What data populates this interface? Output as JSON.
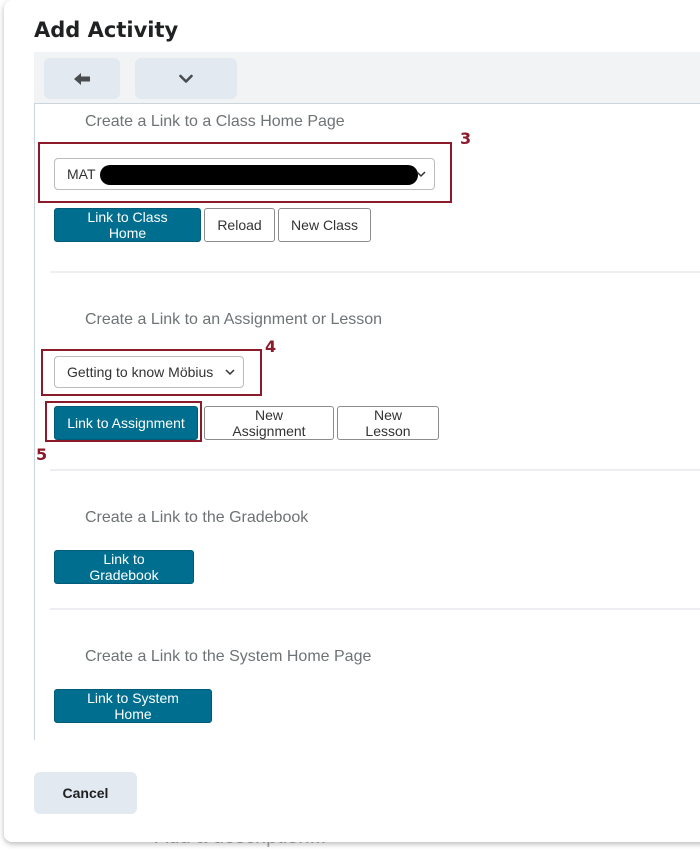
{
  "background": {
    "description_placeholder": "Add a description..."
  },
  "dialog": {
    "title": "Add Activity",
    "toolbar": {
      "back_icon": "arrow-left-icon",
      "menu_icon": "chevron-down-icon"
    },
    "cancel_label": "Cancel"
  },
  "sections": {
    "class_home": {
      "title": "Create a Link to a Class Home Page",
      "select_value": "MAT",
      "buttons": {
        "link": "Link to Class Home",
        "reload": "Reload",
        "new_class": "New Class"
      }
    },
    "assignment": {
      "title": "Create a Link to an Assignment or Lesson",
      "select_value": "Getting to know Möbius",
      "buttons": {
        "link": "Link to Assignment",
        "new_assignment": "New Assignment",
        "new_lesson": "New Lesson"
      }
    },
    "gradebook": {
      "title": "Create a Link to the Gradebook",
      "buttons": {
        "link": "Link to Gradebook"
      }
    },
    "system_home": {
      "title": "Create a Link to the System Home Page",
      "buttons": {
        "link": "Link to System Home"
      }
    }
  },
  "annotations": {
    "step3": "3",
    "step4": "4",
    "step5": "5"
  },
  "colors": {
    "primary": "#006f8f",
    "callout": "#8b1a2b",
    "toolbar_button": "#e3e9f1"
  }
}
